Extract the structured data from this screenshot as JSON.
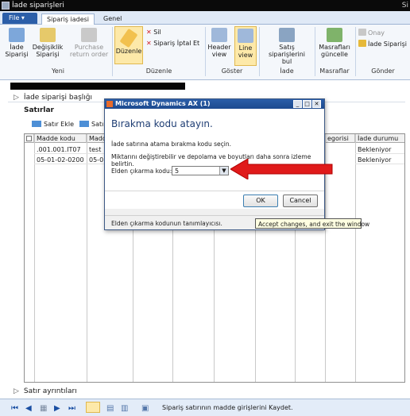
{
  "window": {
    "title": "İade siparişleri",
    "title_right": "Si"
  },
  "ribbon_tabs": {
    "file": "File",
    "tabs": [
      "Sipariş iadesi",
      "Genel"
    ]
  },
  "ribbon": {
    "groups": {
      "new": "Yeni",
      "edit": "Düzenle",
      "show": "Göster",
      "return": "İade",
      "charges": "Masraflar",
      "send": "Gönder"
    },
    "buttons": {
      "return_order": [
        "İade",
        "Siparişi"
      ],
      "change_order": [
        "Değişiklik",
        "Siparişi"
      ],
      "purchase_return": [
        "Purchase",
        "return order"
      ],
      "edit": "Düzenle",
      "delete": "Sil",
      "cancel_return": "Sipariş İptal Et",
      "header_view": [
        "Header",
        "view"
      ],
      "line_view": [
        "Line",
        "view"
      ],
      "find_sales": [
        "Satış siparişlerini",
        "bul"
      ],
      "update_charges": [
        "Masrafları",
        "güncelle"
      ],
      "approve": "Onay",
      "return_order_send": "İade Siparişi"
    }
  },
  "form": {
    "header_section": "İade siparişi başlığı",
    "lines_label": "Satırlar",
    "add_line": "Satır Ekle",
    "line_btn2": "Satır",
    "details_section": "Satır ayrıntıları"
  },
  "grid": {
    "columns": [
      "Madde kodu",
      "Madde",
      "egorisi",
      "İade durumu"
    ],
    "rows": [
      {
        "item_code": ".001.001.IT07",
        "item": "test",
        "status": "Bekleniyor"
      },
      {
        "item_code": "05-01-02-0200",
        "item": "05-01",
        "status": "Bekleniyor"
      }
    ]
  },
  "dialog": {
    "title": "Microsoft Dynamics AX (1)",
    "heading": "Bırakma kodu atayın.",
    "line1": "İade satırına atama bırakma kodu seçin.",
    "line2": "Miktarını değiştirebilir ve depolama ve boyutları daha sonra izleme belirtin.",
    "field_label": "Elden çıkarma kodu:",
    "field_value": "5",
    "ok": "OK",
    "cancel": "Cancel",
    "footer_help": "Elden çıkarma kodunun tanımlayıcısı.",
    "tooltip": "Accept changes, and exit the window"
  },
  "status": {
    "message": "Sipariş satırının madde girişlerini Kaydet."
  },
  "colors": {
    "accent": "#2b5ea8",
    "highlight": "#fde9a9",
    "arrow": "#e01a1a"
  }
}
